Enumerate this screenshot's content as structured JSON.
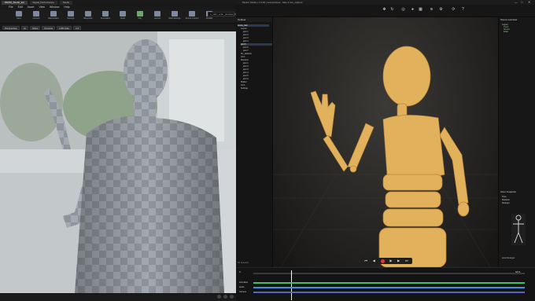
{
  "left_app": {
    "tabs": [
      "DEMO_Studio_Ed",
      "Digital_Performance",
      "Studio"
    ],
    "menu": [
      "File",
      "Edit",
      "Asset",
      "View",
      "Window",
      "Help"
    ],
    "toolbar": [
      "Save",
      "Content",
      "Marketplace",
      "Settings",
      "Blueprints",
      "Cinematics",
      "Build",
      "Play",
      "Launch",
      "Multi Settings",
      "Source Control",
      "Publish",
      "Preview"
    ],
    "search_value": "e_start_scan_prestige_0",
    "viewport_bar": [
      "Perspective",
      "Lit",
      "Show",
      "Preview",
      "LOD Auto",
      "1.0"
    ]
  },
  "right_app": {
    "title": "Motion Studio | 1.0.60 | scene/scene - take 3 son_capture",
    "window_controls": [
      "—",
      "□",
      "✕"
    ],
    "outliner": {
      "header": "Outliner",
      "items": [
        "scene_root",
        "Layout",
        "joint 1",
        "joint 2",
        "joint 3",
        "joint 4",
        "joint 5",
        "joint 6",
        "joint 7",
        "fbx_skeleton",
        "Joint",
        "Skeleton",
        "joint 1",
        "joint 2",
        "joint 3",
        "joint 4",
        "joint 5",
        "joint 6",
        "Marker",
        "Joint",
        "Settings"
      ],
      "footer": "No Selection"
    },
    "right_panel": {
      "title": "Scene overview",
      "rows": [
        "Layout",
        "Track",
        "Stream",
        "Actor"
      ],
      "lower_title": "Actor Inspector",
      "lower_rows": [
        "Pose",
        "Skeleton",
        "Retarget"
      ],
      "panel_label": "Actor Retarget"
    },
    "timeline": {
      "range_start": "0",
      "range_end": "5871",
      "tracks": [
        "Animation",
        "Audio",
        "Camera"
      ]
    }
  }
}
